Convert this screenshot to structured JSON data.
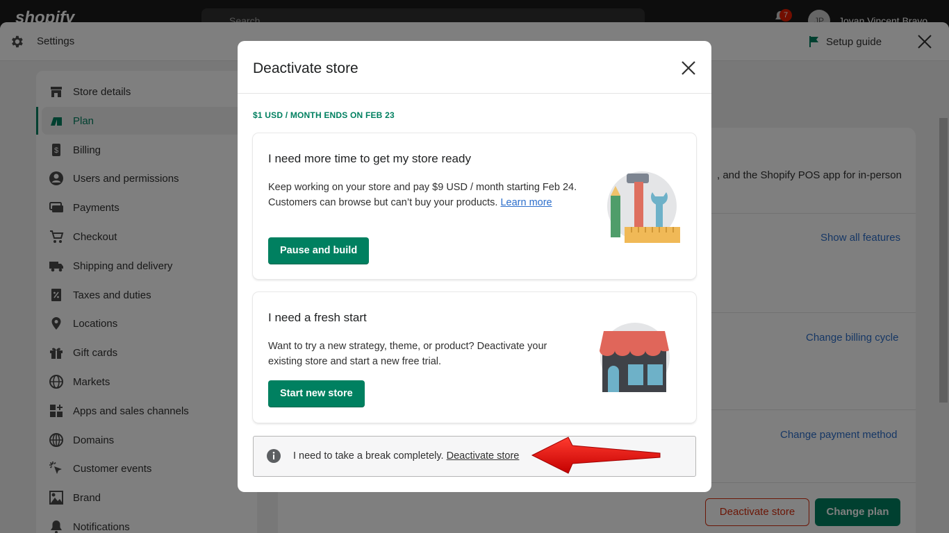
{
  "topbar": {
    "brand": "shopify",
    "search_placeholder": "Search",
    "notification_count": "7",
    "avatar_initials": "JP",
    "user_name": "Jovan Vincent Bravo"
  },
  "settings": {
    "title": "Settings",
    "setup_guide": "Setup guide"
  },
  "sidebar": {
    "items": [
      {
        "label": "Store details",
        "icon": "store-icon"
      },
      {
        "label": "Plan",
        "icon": "plan-icon",
        "active": true
      },
      {
        "label": "Billing",
        "icon": "billing-icon"
      },
      {
        "label": "Users and permissions",
        "icon": "user-icon"
      },
      {
        "label": "Payments",
        "icon": "payments-icon"
      },
      {
        "label": "Checkout",
        "icon": "cart-icon"
      },
      {
        "label": "Shipping and delivery",
        "icon": "truck-icon"
      },
      {
        "label": "Taxes and duties",
        "icon": "tax-icon"
      },
      {
        "label": "Locations",
        "icon": "location-icon"
      },
      {
        "label": "Gift cards",
        "icon": "gift-icon"
      },
      {
        "label": "Markets",
        "icon": "globe-icon"
      },
      {
        "label": "Apps and sales channels",
        "icon": "apps-icon"
      },
      {
        "label": "Domains",
        "icon": "domains-icon"
      },
      {
        "label": "Customer events",
        "icon": "cursor-icon"
      },
      {
        "label": "Brand",
        "icon": "brand-icon"
      },
      {
        "label": "Notifications",
        "icon": "bell-icon"
      }
    ]
  },
  "main": {
    "pos_text": ", and the Shopify POS app for in-person",
    "show_all_features": "Show all features",
    "change_billing_cycle": "Change billing cycle",
    "change_payment_method": "Change payment method",
    "deactivate_store": "Deactivate store",
    "change_plan": "Change plan"
  },
  "modal": {
    "title": "Deactivate store",
    "plan_note": "$1 USD / MONTH ENDS ON FEB 23",
    "option1": {
      "title": "I need more time to get my store ready",
      "desc": "Keep working on your store and pay $9 USD / month starting Feb 24. Customers can browse but can’t buy your products.",
      "link": "Learn more",
      "button": "Pause and build"
    },
    "option2": {
      "title": "I need a fresh start",
      "desc": "Want to try a new strategy, theme, or product? Deactivate your existing store and start a new free trial.",
      "button": "Start new store"
    },
    "break": {
      "text": "I need to take a break completely.",
      "link": "Deactivate store"
    }
  },
  "colors": {
    "accent_green": "#008060",
    "link_blue": "#2c6ecb",
    "critical_red": "#d72c0d",
    "annotation_red": "#e00000"
  }
}
